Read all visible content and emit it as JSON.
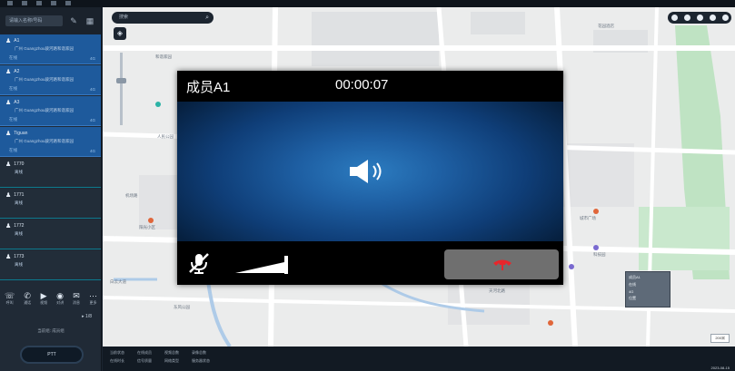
{
  "call": {
    "member_name": "成员A1",
    "timer": "00:00:07",
    "icons": {
      "speaker": "speaker-icon",
      "mute": "mic-muted-icon",
      "volume": "volume-slider",
      "hangup": "hangup-icon"
    },
    "colors": {
      "hangup_icon": "#e8262b",
      "body_center": "#2c7cc0",
      "body_edge": "#06203f"
    }
  },
  "sidebar": {
    "search_placeholder": "请输入名称/号码",
    "members": [
      {
        "name": "A1",
        "sub": "广州 Guangzhou骏河路和谐家园",
        "meta": "在线",
        "meta_r": "4G",
        "state": "active"
      },
      {
        "name": "A2",
        "sub": "广州 Guangzhou骏河路和谐家园",
        "meta": "在线",
        "meta_r": "4G",
        "state": "active"
      },
      {
        "name": "A3",
        "sub": "广州 Guangzhou骏河路和谐家园",
        "meta": "在线",
        "meta_r": "4G",
        "state": "active"
      },
      {
        "name": "Tiguan",
        "sub": "广州 Guangzhou骏河路和谐家园",
        "meta": "在线",
        "meta_r": "4G",
        "state": "active"
      },
      {
        "name": "1770",
        "sub": "离线",
        "meta": "",
        "meta_r": "",
        "state": "idle"
      },
      {
        "name": "1771",
        "sub": "离线",
        "meta": "",
        "meta_r": "",
        "state": "idle"
      },
      {
        "name": "1772",
        "sub": "离线",
        "meta": "",
        "meta_r": "",
        "state": "idle"
      },
      {
        "name": "1773",
        "sub": "离线",
        "meta": "",
        "meta_r": "",
        "state": "idle"
      }
    ],
    "tools": [
      "呼叫",
      "通话",
      "视频",
      "对讲",
      "消息",
      "更多"
    ],
    "mini_label": "▸ 1/8",
    "note": "当前组: 成员组",
    "ptt_label": "PTT"
  },
  "map": {
    "search_placeholder": "搜索",
    "pois": [
      "和谐家园",
      "人民公园",
      "机场路",
      "阳光小区",
      "白云大道",
      "东风公园",
      "城市广场",
      "科技园",
      "天河北路",
      "花园酒店"
    ],
    "mini_card": [
      "成员A1",
      "在线",
      "4G",
      "位置"
    ],
    "scale": "200米"
  },
  "statusbar": {
    "row1": [
      "当前状态",
      "在线成员",
      "视频总数",
      "录像总数"
    ],
    "row2": [
      "在线时长",
      "信号质量",
      "网络类型",
      "服务器状态"
    ],
    "corner": "2023-08-15"
  }
}
